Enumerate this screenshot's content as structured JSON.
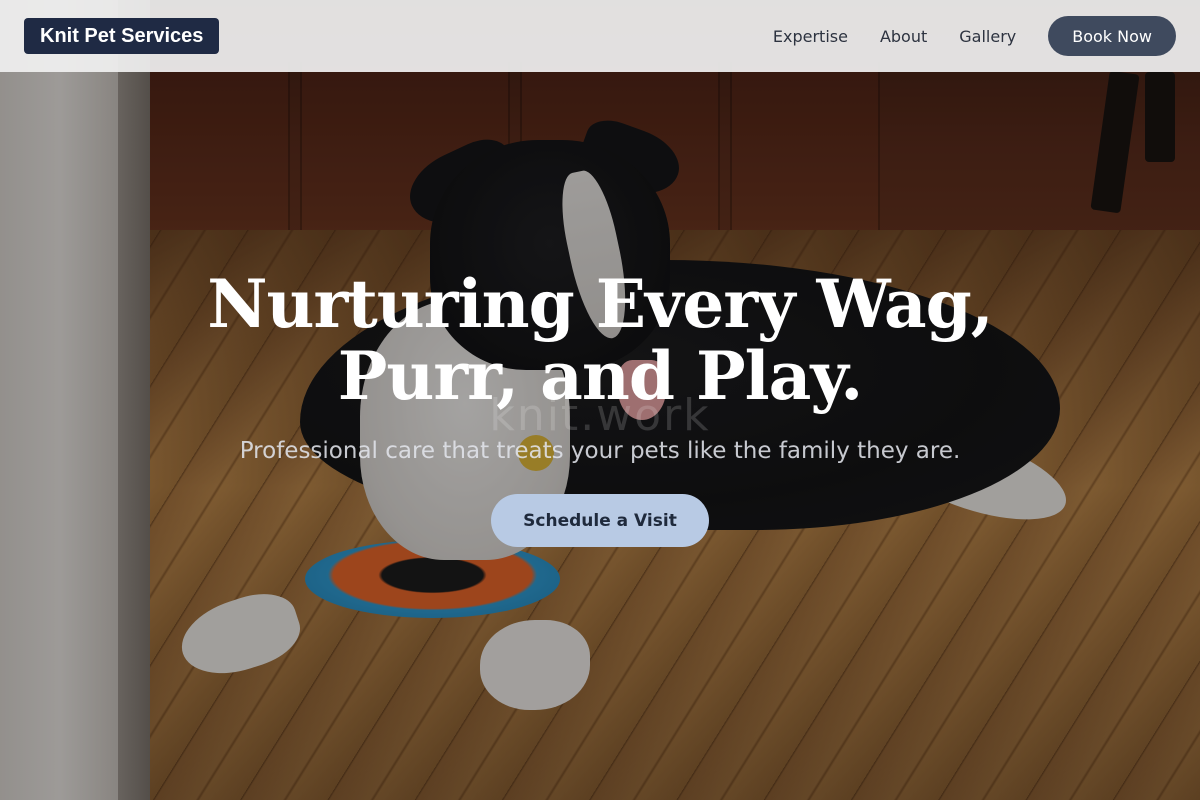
{
  "navbar": {
    "brand": "Knit Pet Services",
    "links": [
      {
        "label": "Expertise"
      },
      {
        "label": "About"
      },
      {
        "label": "Gallery"
      }
    ],
    "cta_label": "Book Now"
  },
  "hero": {
    "title_line1": "Nurturing Every Wag,",
    "title_line2": "Purr, and Play.",
    "subtitle": "Professional care that treats your pets like the family they are.",
    "cta_label": "Schedule a Visit",
    "watermark": "knit.work"
  },
  "colors": {
    "brand_bg": "#1f2a44",
    "book_button": "#3f4a5e",
    "cta_button": "#b8cae4",
    "navbar_bg": "#f0f0f0"
  }
}
